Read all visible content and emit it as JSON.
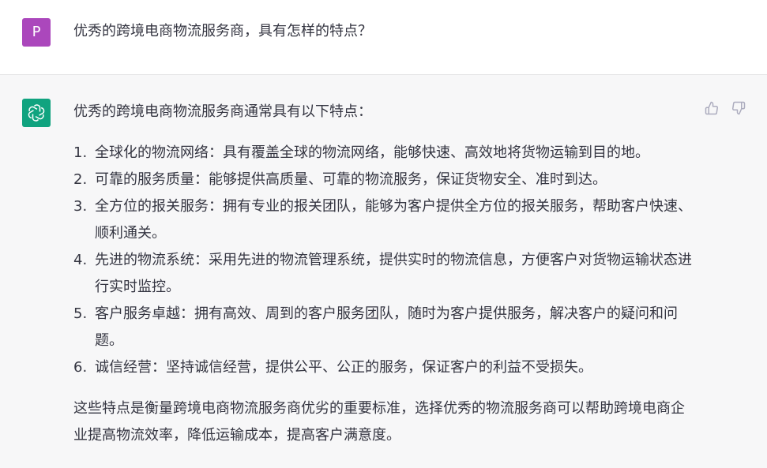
{
  "user": {
    "avatar_letter": "P",
    "avatar_color": "#ab47bc",
    "question": "优秀的跨境电商物流服务商，具有怎样的特点？"
  },
  "assistant": {
    "avatar_icon": "openai-logo-icon",
    "avatar_color": "#10a37f",
    "intro": "优秀的跨境电商物流服务商通常具有以下特点：",
    "points": [
      {
        "num": "1.",
        "text": "全球化的物流网络：具有覆盖全球的物流网络，能够快速、高效地将货物运输到目的地。"
      },
      {
        "num": "2.",
        "text": "可靠的服务质量：能够提供高质量、可靠的物流服务，保证货物安全、准时到达。"
      },
      {
        "num": "3.",
        "text": "全方位的报关服务：拥有专业的报关团队，能够为客户提供全方位的报关服务，帮助客户快速、顺利通关。"
      },
      {
        "num": "4.",
        "text": "先进的物流系统：采用先进的物流管理系统，提供实时的物流信息，方便客户对货物运输状态进行实时监控。"
      },
      {
        "num": "5.",
        "text": "客户服务卓越：拥有高效、周到的客户服务团队，随时为客户提供服务，解决客户的疑问和问题。"
      },
      {
        "num": "6.",
        "text": "诚信经营：坚持诚信经营，提供公平、公正的服务，保证客户的利益不受损失。"
      }
    ],
    "conclusion": "这些特点是衡量跨境电商物流服务商优劣的重要标准，选择优秀的物流服务商可以帮助跨境电商企业提高物流效率，降低运输成本，提高客户满意度。"
  },
  "feedback": {
    "thumbs_up_icon": "thumbs-up-icon",
    "thumbs_down_icon": "thumbs-down-icon"
  }
}
